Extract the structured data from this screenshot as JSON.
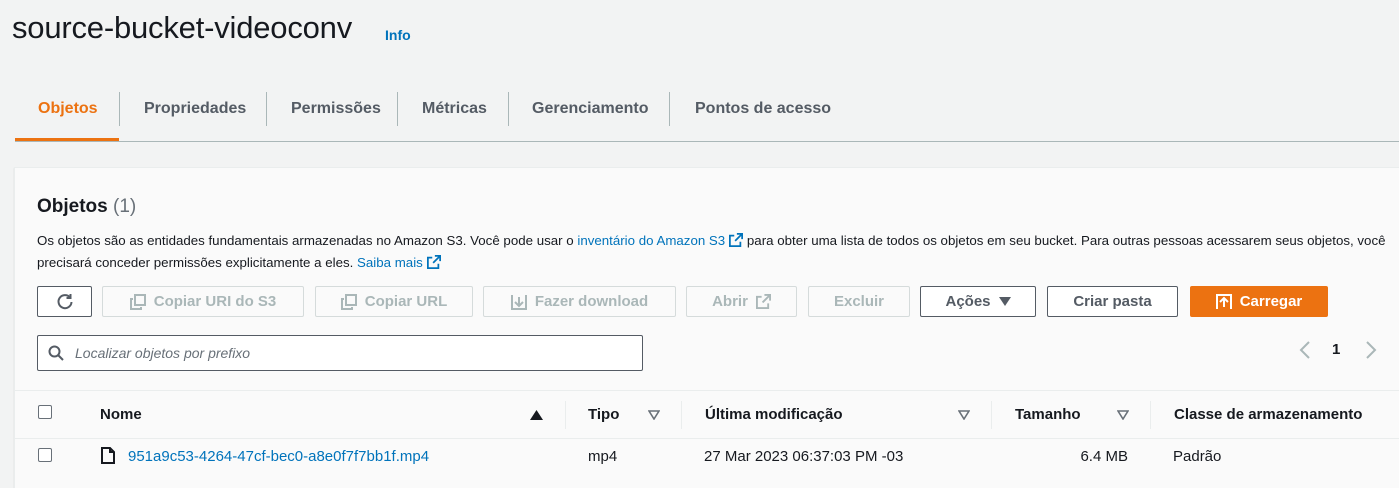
{
  "header": {
    "title": "source-bucket-videoconv",
    "info_label": "Info"
  },
  "tabs": [
    {
      "label": "Objetos",
      "active": true
    },
    {
      "label": "Propriedades"
    },
    {
      "label": "Permissões"
    },
    {
      "label": "Métricas"
    },
    {
      "label": "Gerenciamento"
    },
    {
      "label": "Pontos de acesso"
    }
  ],
  "objects": {
    "title": "Objetos",
    "count": "(1)",
    "description": {
      "part1": "Os objetos são as entidades fundamentais armazenadas no Amazon S3. Você pode usar o ",
      "link1": "inventário do Amazon S3",
      "part2": " para obter uma lista de todos os objetos em seu bucket. Para outras pessoas acessarem seus objetos, você precisará conceder permissões explicitamente a eles. ",
      "link2": "Saiba mais"
    },
    "toolbar": {
      "copy_uri": "Copiar URI do S3",
      "copy_url": "Copiar URL",
      "download": "Fazer download",
      "open": "Abrir",
      "delete": "Excluir",
      "actions": "Ações",
      "create_folder": "Criar pasta",
      "upload": "Carregar"
    },
    "search": {
      "placeholder": "Localizar objetos por prefixo"
    },
    "pagination": {
      "current_page": "1"
    },
    "columns": {
      "name": "Nome",
      "type": "Tipo",
      "modified": "Última modificação",
      "size": "Tamanho",
      "storage_class": "Classe de armazenamento"
    },
    "rows": [
      {
        "name": "951a9c53-4264-47cf-bec0-a8e0f7f7bb1f.mp4",
        "type": "mp4",
        "modified": "27 Mar 2023 06:37:03 PM -03",
        "size": "6.4 MB",
        "storage_class": "Padrão"
      }
    ]
  },
  "colors": {
    "accent": "#ec7211",
    "link": "#0073bb",
    "text": "#16191f",
    "muted": "#aab7b8"
  }
}
